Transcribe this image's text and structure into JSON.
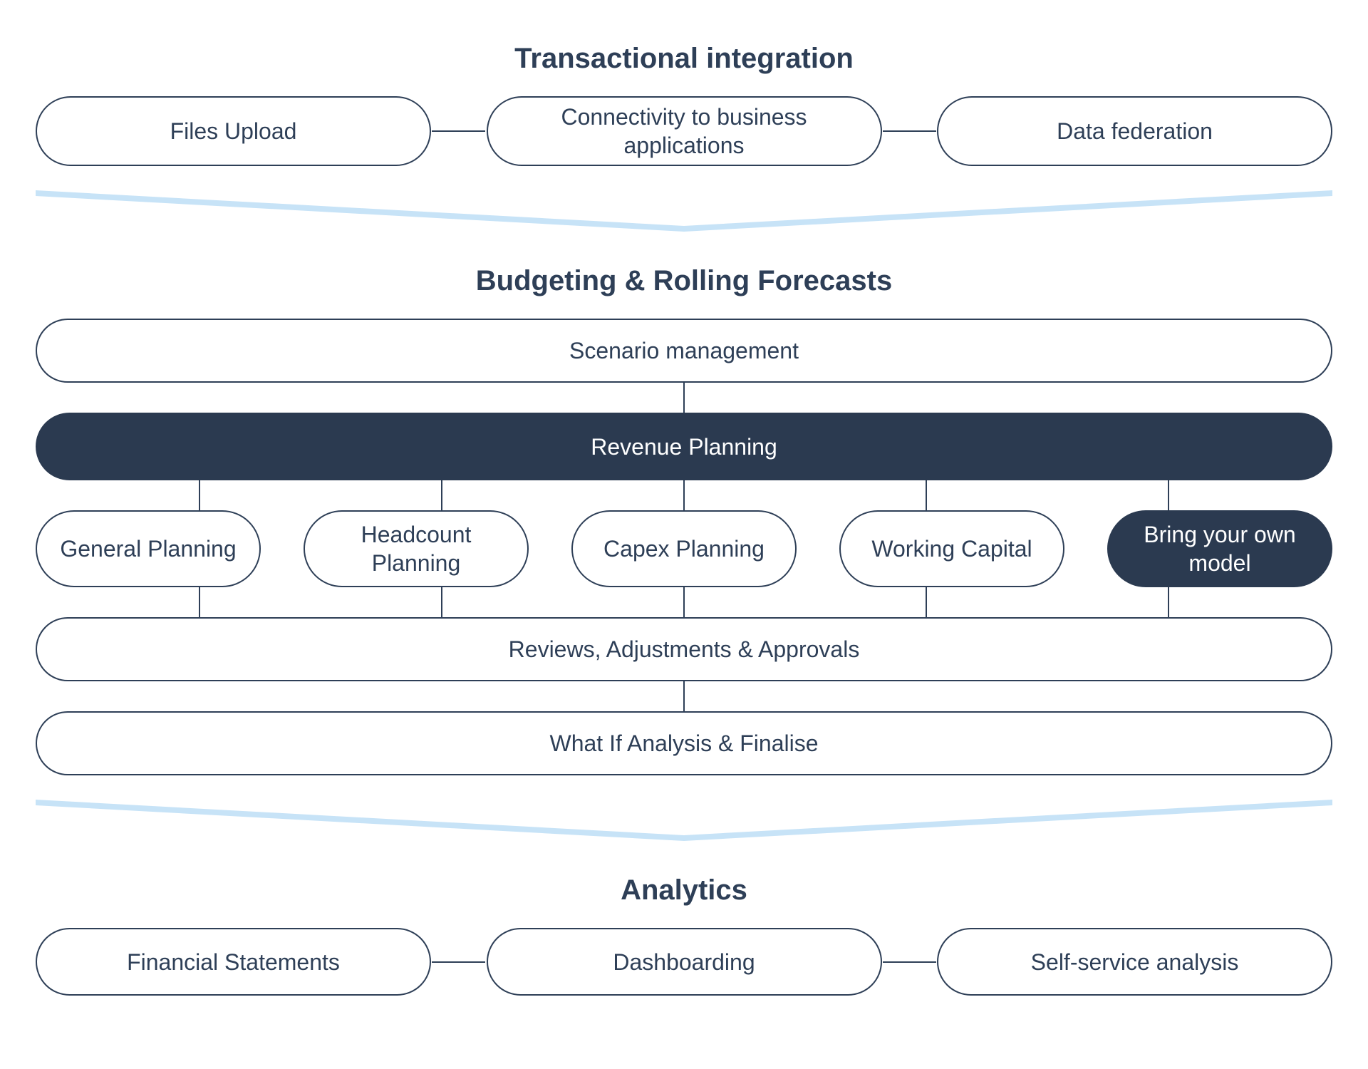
{
  "colors": {
    "navy": "#2e3f57",
    "sky": "#c7e3f7",
    "white": "#ffffff"
  },
  "sections": {
    "integration": {
      "title": "Transactional integration",
      "items": [
        "Files Upload",
        "Connectivity to business applications",
        "Data federation"
      ]
    },
    "budgeting": {
      "title": "Budgeting & Rolling Forecasts",
      "scenario": "Scenario management",
      "revenue": "Revenue Planning",
      "planning_items": [
        "General Planning",
        "Headcount Planning",
        "Capex Planning",
        "Working Capital",
        "Bring your own model"
      ],
      "reviews": "Reviews, Adjustments & Approvals",
      "whatif": "What If Analysis & Finalise"
    },
    "analytics": {
      "title": "Analytics",
      "items": [
        "Financial Statements",
        "Dashboarding",
        "Self-service analysis"
      ]
    }
  }
}
